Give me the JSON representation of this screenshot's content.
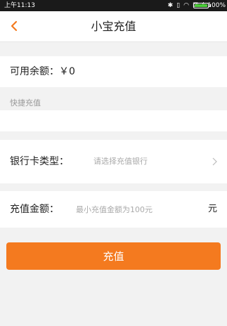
{
  "status_bar": {
    "time": "上午11:13",
    "icons": [
      "bluetooth-icon",
      "vibrate-icon",
      "wifi-icon",
      "sim-icon",
      "charging-icon"
    ],
    "battery_level": 1.0,
    "battery_percent": "100%",
    "battery_color": "#4ccd3a"
  },
  "nav": {
    "title": "小宝充值",
    "back_icon": "chevron-left-icon",
    "back_color": "#f47a1f"
  },
  "balance": {
    "text": "可用余额：￥0"
  },
  "quick_recharge": {
    "label": "快捷充值"
  },
  "bank_card": {
    "label": "银行卡类型：",
    "placeholder": "请选择充值银行",
    "chevron_icon": "chevron-right-icon"
  },
  "amount": {
    "label": "充值金额：",
    "placeholder": "最小充值金额为100元",
    "unit": "元"
  },
  "submit": {
    "label": "充值",
    "color": "#f47a1f"
  }
}
